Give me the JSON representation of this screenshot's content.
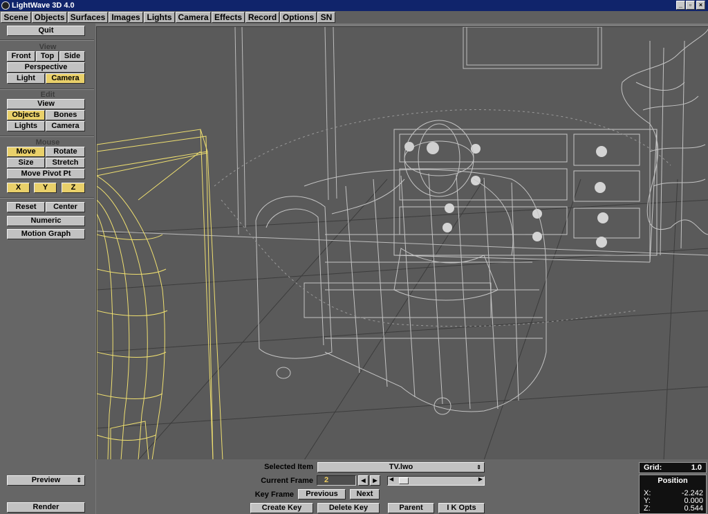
{
  "window": {
    "title": "LightWave 3D 4.0"
  },
  "menu": [
    "Scene",
    "Objects",
    "Surfaces",
    "Images",
    "Lights",
    "Camera",
    "Effects",
    "Record",
    "Options",
    "SN"
  ],
  "left": {
    "quit": "Quit",
    "view_section": "View",
    "front": "Front",
    "top": "Top",
    "side": "Side",
    "perspective": "Perspective",
    "light": "Light",
    "camera": "Camera",
    "edit_section": "Edit",
    "edit_view": "View",
    "objects": "Objects",
    "bones": "Bones",
    "lights": "Lights",
    "edit_camera": "Camera",
    "mouse_section": "Mouse",
    "move": "Move",
    "rotate": "Rotate",
    "size": "Size",
    "stretch": "Stretch",
    "move_pivot": "Move Pivot Pt",
    "x": "X",
    "y": "Y",
    "z": "Z",
    "reset": "Reset",
    "center": "Center",
    "numeric": "Numeric",
    "motion_graph": "Motion Graph",
    "preview": "Preview",
    "render": "Render"
  },
  "bottom": {
    "selected_item_label": "Selected Item",
    "selected_item_value": "TV.lwo",
    "current_frame_label": "Current Frame",
    "current_frame_value": "2",
    "key_frame_label": "Key Frame",
    "previous": "Previous",
    "next": "Next",
    "create_key": "Create Key",
    "delete_key": "Delete Key",
    "parent": "Parent",
    "ik_opts": "I K Opts"
  },
  "info": {
    "grid_label": "Grid:",
    "grid_value": "1.0",
    "position_title": "Position",
    "x_label": "X:",
    "x_value": "-2.242",
    "y_label": "Y:",
    "y_value": "0.000",
    "z_label": "Z:",
    "z_value": "0.544"
  },
  "colors": {
    "active_button": "#e9d06a",
    "selected_wire": "#f0e070",
    "wire": "#c8c8c8",
    "title_bar": "#10246b"
  }
}
